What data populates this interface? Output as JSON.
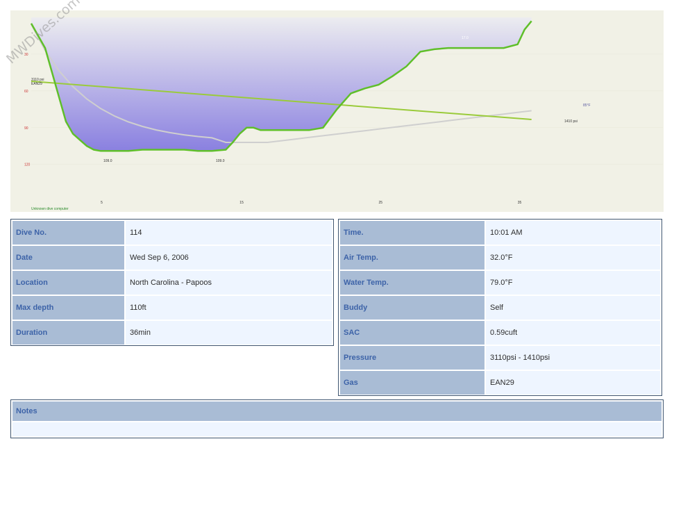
{
  "watermark": "MWDives.com",
  "colors": {
    "plot_bg": "#f1f1e6",
    "label_bg": "#a9bcd5",
    "label_text": "#3d63a8",
    "value_bg": "#eef5ff",
    "border": "#3f5570",
    "depth_fill_top": "#eaeaf0",
    "depth_fill_bottom": "#8a80e0",
    "depth_line": "#5fbf2a",
    "pressure_line": "#8cc83a",
    "temp_line": "#cfcfcf"
  },
  "profile": {
    "computer_label": "Unknown dive computer",
    "depth_ticks": [
      "30",
      "60",
      "90",
      "120"
    ],
    "time_ticks": [
      "5",
      "15",
      "25",
      "35"
    ],
    "annotations": {
      "start_pressure": "3110 psi",
      "gas": "EAN29",
      "end_pressure": "1410 psi",
      "temp": "85°F",
      "depth_marker_1": "109.0",
      "depth_marker_2": "109.0",
      "surface_marker": "17.0"
    }
  },
  "chart_data": {
    "type": "line",
    "xlabel": "",
    "ylabel": "",
    "xlim": [
      0,
      40
    ],
    "ylim_depth_ft": [
      0,
      150
    ],
    "series": [
      {
        "x": [
          0,
          0.5,
          1,
          1.5,
          2,
          2.5,
          3,
          3.5,
          4,
          4.5,
          5,
          6,
          7,
          8,
          9,
          10,
          11,
          12,
          13,
          14,
          14.5,
          15,
          15.5,
          16,
          16.5,
          17,
          18,
          19,
          20,
          21,
          22,
          23,
          24,
          25,
          26,
          27,
          28,
          29,
          30,
          31,
          32,
          33,
          34,
          35,
          35.5,
          36
        ],
        "values": [
          5,
          15,
          25,
          45,
          65,
          85,
          95,
          100,
          105,
          108,
          109,
          109,
          109,
          108,
          108,
          108,
          108,
          109,
          109,
          108,
          102,
          95,
          90,
          90,
          92,
          92,
          92,
          92,
          92,
          90,
          75,
          62,
          58,
          55,
          48,
          40,
          28,
          26,
          25,
          25,
          25,
          25,
          25,
          22,
          10,
          3
        ]
      },
      {
        "x": [
          0,
          36
        ],
        "values": [
          3110,
          1410
        ]
      },
      {
        "x": [
          0,
          2,
          4,
          6,
          8,
          10,
          12,
          14,
          16,
          18,
          20,
          22,
          24,
          26,
          28,
          30,
          32,
          34,
          36
        ],
        "values": [
          null,
          null,
          null,
          null,
          null,
          null,
          null,
          null,
          null,
          null,
          null,
          null,
          null,
          null,
          null,
          null,
          null,
          null,
          null
        ]
      }
    ]
  },
  "dive_table": {
    "rows": [
      {
        "label": "Dive No.",
        "value": "114"
      },
      {
        "label": "Date",
        "value": "Wed Sep 6, 2006"
      },
      {
        "label": "Location",
        "value": "North Carolina - Papoos"
      },
      {
        "label": "Max depth",
        "value": "110ft"
      },
      {
        "label": "Duration",
        "value": "36min"
      }
    ]
  },
  "conditions_table": {
    "rows": [
      {
        "label": "Time.",
        "value": "10:01 AM"
      },
      {
        "label": "Air Temp.",
        "value": "32.0°F"
      },
      {
        "label": "Water Temp.",
        "value": "79.0°F"
      },
      {
        "label": "Buddy",
        "value": "Self"
      },
      {
        "label": "SAC",
        "value": "0.59cuft"
      },
      {
        "label": "Pressure",
        "value": "3110psi - 1410psi"
      },
      {
        "label": "Gas",
        "value": "EAN29"
      }
    ]
  },
  "notes": {
    "label": "Notes",
    "value": ""
  }
}
